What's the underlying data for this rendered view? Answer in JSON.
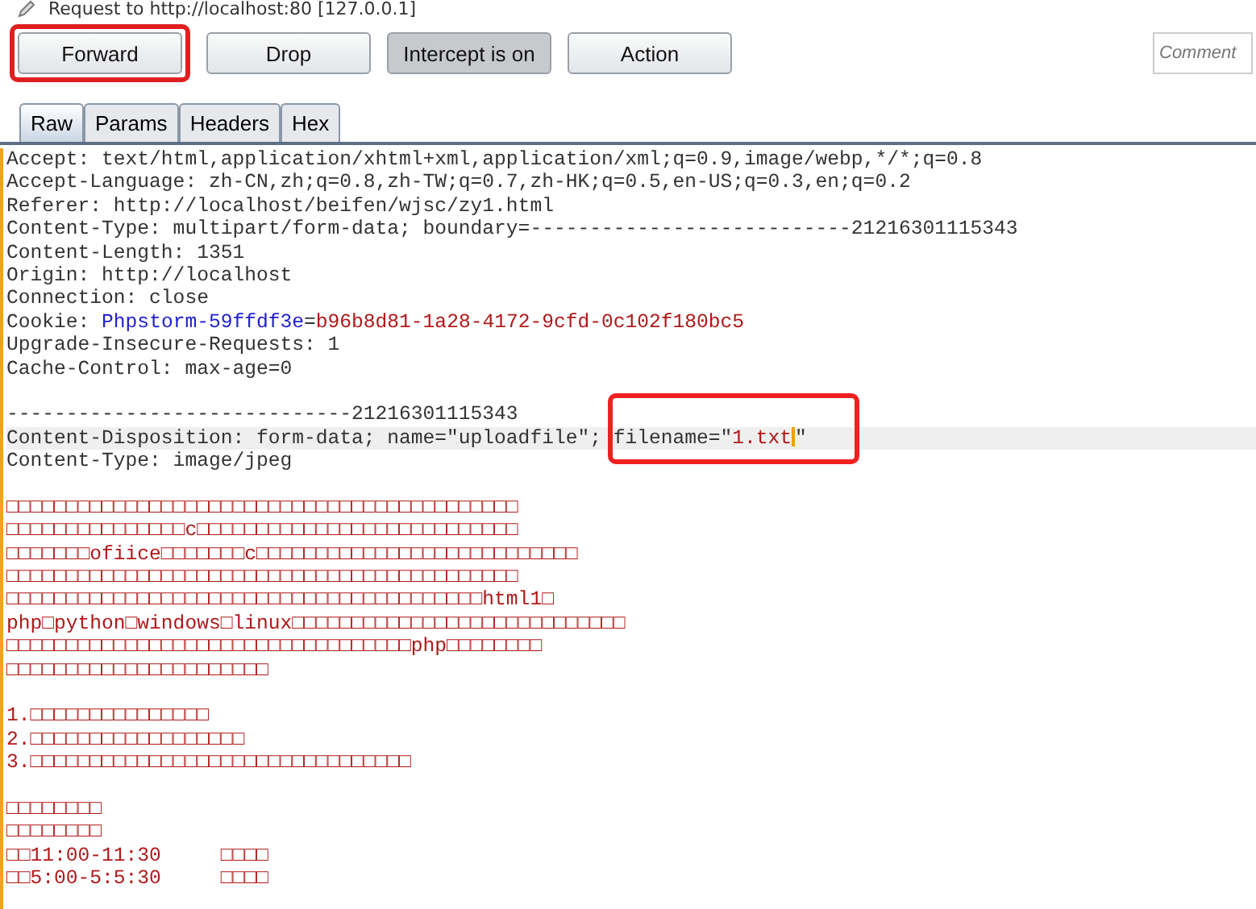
{
  "window": {
    "title": "Request to http://localhost:80  [127.0.0.1]"
  },
  "buttons": [
    {
      "label": "Forward",
      "kind": "normal",
      "highlighted": true
    },
    {
      "label": "Drop",
      "kind": "normal",
      "highlighted": false
    },
    {
      "label": "Intercept is on",
      "kind": "toggle",
      "highlighted": false
    },
    {
      "label": "Action",
      "kind": "normal",
      "highlighted": false
    }
  ],
  "comment": {
    "placeholder": "Comment"
  },
  "tabs": [
    {
      "label": "Raw",
      "selected": true
    },
    {
      "label": "Params",
      "selected": false
    },
    {
      "label": "Headers",
      "selected": false
    },
    {
      "label": "Hex",
      "selected": false
    }
  ],
  "lines": [
    {
      "kind": "header",
      "text": "Accept: text/html,application/xhtml+xml,application/xml;q=0.9,image/webp,*/*;q=0.8"
    },
    {
      "kind": "header",
      "text": "Accept-Language: zh-CN,zh;q=0.8,zh-TW;q=0.7,zh-HK;q=0.5,en-US;q=0.3,en;q=0.2"
    },
    {
      "kind": "header",
      "text": "Referer: http://localhost/beifen/wjsc/zy1.html"
    },
    {
      "kind": "header",
      "text": "Content-Type: multipart/form-data; boundary=---------------------------21216301115343"
    },
    {
      "kind": "header",
      "text": "Content-Length: 1351"
    },
    {
      "kind": "header",
      "text": "Origin: http://localhost"
    },
    {
      "kind": "header",
      "text": "Connection: close"
    },
    {
      "kind": "cookie",
      "text": "Cookie: ",
      "name": "Phpstorm-59ffdf3e",
      "sep": "=",
      "value": "b96b8d81-1a28-4172-9cfd-0c102f180bc5"
    },
    {
      "kind": "header",
      "text": "Upgrade-Insecure-Requests: 1"
    },
    {
      "kind": "header",
      "text": "Cache-Control: max-age=0"
    },
    {
      "kind": "blank"
    },
    {
      "kind": "header",
      "text": "-----------------------------21216301115343"
    },
    {
      "kind": "filename",
      "current": true,
      "text": "Content-Disposition: form-data; name=\"uploadfile\"; filename=\"",
      "value": "1.txt",
      "tail": "\""
    },
    {
      "kind": "header",
      "text": "Content-Type: image/jpeg"
    },
    {
      "kind": "blank"
    },
    {
      "kind": "body",
      "text": "□□□□□□□□□□□□□□□□□□□□□□□□□□□□□□□□□□□□□□□□□□□"
    },
    {
      "kind": "body",
      "text": "□□□□□□□□□□□□□□□c□□□□□□□□□□□□□□□□□□□□□□□□□□□"
    },
    {
      "kind": "body",
      "text": "□□□□□□□ofiice□□□□□□□c□□□□□□□□□□□□□□□□□□□□□□□□□□□"
    },
    {
      "kind": "body",
      "text": "□□□□□□□□□□□□□□□□□□□□□□□□□□□□□□□□□□□□□□□□□□□"
    },
    {
      "kind": "body",
      "text": "□□□□□□□□□□□□□□□□□□□□□□□□□□□□□□□□□□□□□□□□html1□"
    },
    {
      "kind": "body",
      "text": "php□python□windows□linux□□□□□□□□□□□□□□□□□□□□□□□□□□□□"
    },
    {
      "kind": "body",
      "text": "□□□□□□□□□□□□□□□□□□□□□□□□□□□□□□□□□□php□□□□□□□□"
    },
    {
      "kind": "body",
      "text": "□□□□□□□□□□□□□□□□□□□□□□"
    },
    {
      "kind": "blank"
    },
    {
      "kind": "body",
      "text": "1.□□□□□□□□□□□□□□□"
    },
    {
      "kind": "body",
      "text": "2.□□□□□□□□□□□□□□□□□□"
    },
    {
      "kind": "body",
      "text": "3.□□□□□□□□□□□□□□□□□□□□□□□□□□□□□□□□"
    },
    {
      "kind": "blank"
    },
    {
      "kind": "body",
      "text": "□□□□□□□□"
    },
    {
      "kind": "body",
      "text": "□□□□□□□□"
    },
    {
      "kind": "body",
      "text": "□□11:00-11:30     □□□□"
    },
    {
      "kind": "body",
      "text": "□□5:00-5:5:30     □□□□"
    }
  ]
}
